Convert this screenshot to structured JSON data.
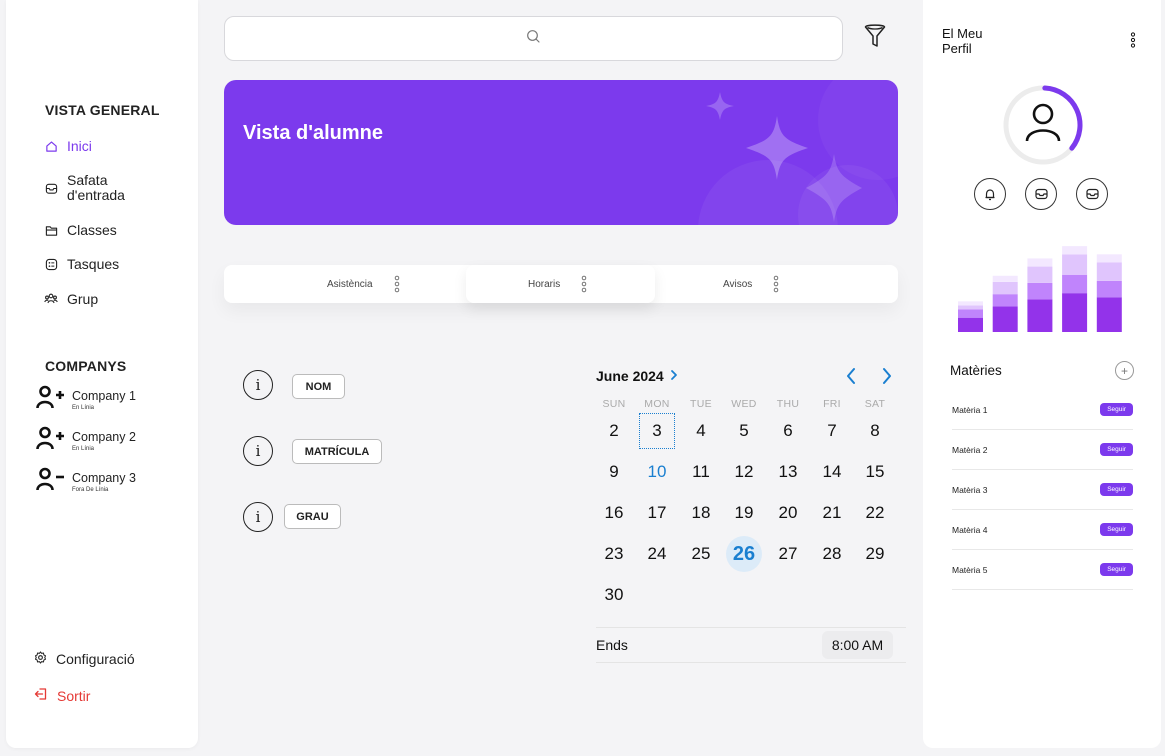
{
  "sidebar": {
    "section_overview": "VISTA GENERAL",
    "nav": [
      {
        "label": "Inici",
        "icon": "home-icon",
        "active": true
      },
      {
        "label": "Safata d'entrada",
        "icon": "inbox-icon",
        "active": false
      },
      {
        "label": "Classes",
        "icon": "folder-icon",
        "active": false
      },
      {
        "label": "Tasques",
        "icon": "tasks-icon",
        "active": false
      },
      {
        "label": "Grup",
        "icon": "group-icon",
        "active": false
      }
    ],
    "section_companions": "COMPANYS",
    "companions": [
      {
        "name": "Company 1",
        "status": "En Línia",
        "icon": "user-plus-icon"
      },
      {
        "name": "Company 2",
        "status": "En Línia",
        "icon": "user-plus-icon"
      },
      {
        "name": "Company 3",
        "status": "Fora De Línia",
        "icon": "user-minus-icon"
      }
    ],
    "settings_label": "Configuració",
    "logout_label": "Sortir"
  },
  "search": {
    "placeholder": ""
  },
  "banner": {
    "title": "Vista d'alumne",
    "color": "#7c3aed"
  },
  "tabs": [
    {
      "label": "Asistència",
      "active": false
    },
    {
      "label": "Horaris",
      "active": true
    },
    {
      "label": "Avisos",
      "active": false
    }
  ],
  "info_fields": [
    {
      "label": "NOM"
    },
    {
      "label": "MATRÍCULA"
    },
    {
      "label": "GRAU"
    }
  ],
  "calendar": {
    "month_label": "June 2024",
    "weekdays": [
      "SUN",
      "MON",
      "TUE",
      "WED",
      "THU",
      "FRI",
      "SAT"
    ],
    "weeks": [
      [
        "2",
        "3",
        "4",
        "5",
        "6",
        "7",
        "8"
      ],
      [
        "9",
        "10",
        "11",
        "12",
        "13",
        "14",
        "15"
      ],
      [
        "16",
        "17",
        "18",
        "19",
        "20",
        "21",
        "22"
      ],
      [
        "23",
        "24",
        "25",
        "26",
        "27",
        "28",
        "29"
      ],
      [
        "30",
        "",
        "",
        "",
        "",
        "",
        ""
      ]
    ],
    "today": "10",
    "selected": "26",
    "focused": "3",
    "ends_label": "Ends",
    "ends_time": "8:00 AM",
    "accent": "#1a7fd0"
  },
  "profile": {
    "title_line1": "El Meu",
    "title_line2": "Perfil",
    "progress_fraction": 0.35,
    "actions": [
      {
        "icon": "bell-icon"
      },
      {
        "icon": "inbox-icon"
      },
      {
        "icon": "inbox-icon"
      }
    ]
  },
  "chart_data": {
    "type": "bar",
    "stacked": true,
    "categories": [
      "",
      "",
      "",
      "",
      ""
    ],
    "series": [
      {
        "values": [
          14,
          25,
          32,
          38,
          34
        ],
        "color": "#9333ea"
      },
      {
        "values": [
          8,
          12,
          16,
          18,
          16
        ],
        "color": "#c084fc"
      },
      {
        "values": [
          4,
          12,
          16,
          20,
          18
        ],
        "color": "#e0c5fd"
      },
      {
        "values": [
          4,
          6,
          8,
          8,
          8
        ],
        "color": "#f3e8ff"
      }
    ],
    "ylim": [
      0,
      90
    ],
    "grid": false
  },
  "subjects": {
    "title": "Matèries",
    "follow_label": "Seguir",
    "items": [
      {
        "name": "Matèria 1"
      },
      {
        "name": "Matèria 2"
      },
      {
        "name": "Matèria 3"
      },
      {
        "name": "Matèria 4"
      },
      {
        "name": "Matèria 5"
      }
    ]
  }
}
